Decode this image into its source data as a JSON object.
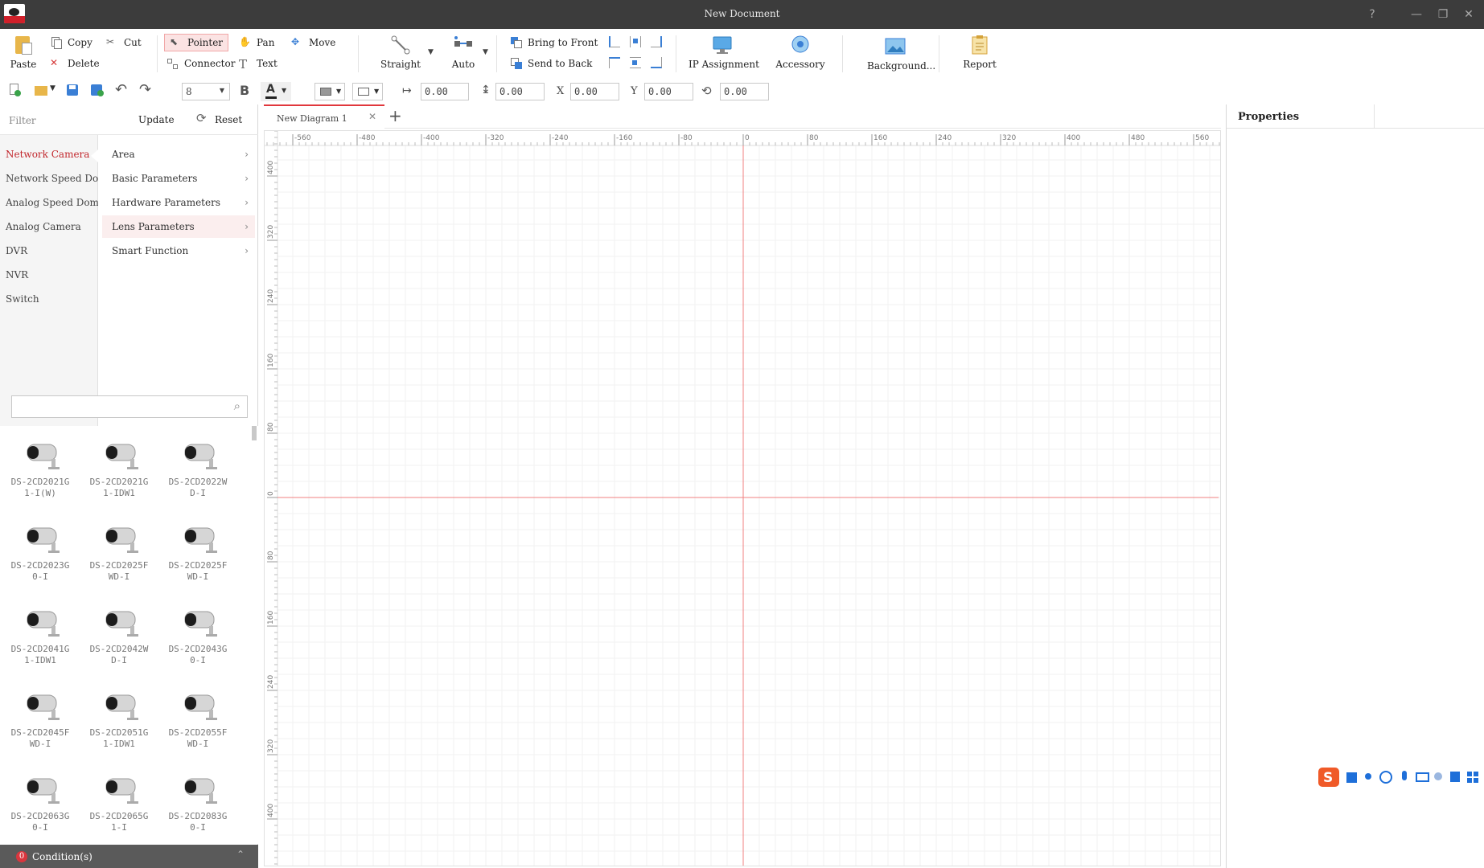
{
  "window": {
    "title": "New Document"
  },
  "ribbon": {
    "paste": "Paste",
    "copy": "Copy",
    "cut": "Cut",
    "delete": "Delete",
    "pointer": "Pointer",
    "pan": "Pan",
    "move": "Move",
    "connector": "Connector",
    "text": "Text",
    "straight": "Straight",
    "auto": "Auto",
    "bring_to_front": "Bring to Front",
    "send_to_back": "Send to Back",
    "ip_assignment": "IP Assignment",
    "accessory": "Accessory",
    "background": "Background...",
    "report": "Report"
  },
  "toolbar": {
    "font_size": "8",
    "bold": "B",
    "text_color": "A",
    "width": "0.00",
    "height": "0.00",
    "x_label": "X",
    "x": "0.00",
    "y_label": "Y",
    "y": "0.00",
    "rotation": "0.00"
  },
  "filter": {
    "label": "Filter",
    "update": "Update",
    "reset": "Reset"
  },
  "categories": [
    "Network Camera",
    "Network Speed Dome",
    "Analog Speed Dome",
    "Analog Camera",
    "DVR",
    "NVR",
    "Switch"
  ],
  "subcategories": [
    "Area",
    "Basic Parameters",
    "Hardware Parameters",
    "Lens Parameters",
    "Smart Function"
  ],
  "devices": [
    "DS-2CD2021G1-I(W)",
    "DS-2CD2021G1-IDW1",
    "DS-2CD2022WD-I",
    "DS-2CD2023G0-I",
    "DS-2CD2025FWD-I",
    "DS-2CD2025FWD-I",
    "DS-2CD2041G1-IDW1",
    "DS-2CD2042WD-I",
    "DS-2CD2043G0-I",
    "DS-2CD2045FWD-I",
    "DS-2CD2051G1-IDW1",
    "DS-2CD2055FWD-I",
    "DS-2CD2063G0-I",
    "DS-2CD2065G1-I",
    "DS-2CD2083G0-I"
  ],
  "status": {
    "count": "0",
    "label": "Condition(s)"
  },
  "canvas": {
    "tab": "New Diagram 1",
    "h_ticks": [
      "-560",
      "-480",
      "-400",
      "-320",
      "-240",
      "-160",
      "-80",
      "0",
      "80",
      "160",
      "240",
      "320",
      "400",
      "480",
      "560"
    ],
    "v_ticks": [
      "400",
      "320",
      "240",
      "160",
      "80",
      "0",
      "80",
      "160",
      "240",
      "320",
      "400"
    ]
  },
  "properties": {
    "title": "Properties"
  },
  "colors": {
    "accent": "#c2272d",
    "axis": "#f08080",
    "title_bg": "#3c3c3c"
  }
}
